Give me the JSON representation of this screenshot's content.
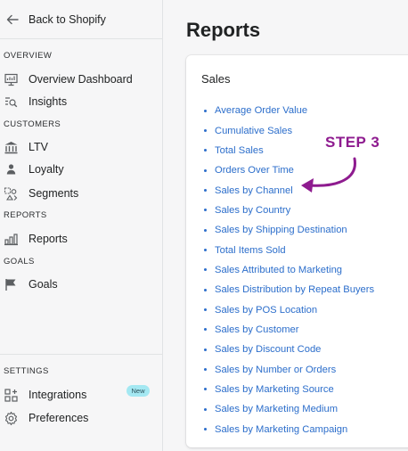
{
  "sidebar": {
    "back_label": "Back to Shopify",
    "sections": {
      "overview": "OVERVIEW",
      "customers": "CUSTOMERS",
      "reports": "REPORTS",
      "goals": "GOALS",
      "settings": "SETTINGS"
    },
    "items": {
      "overview_dashboard": {
        "label": "Overview Dashboard",
        "icon": "dashboard-icon"
      },
      "insights": {
        "label": "Insights",
        "icon": "insights-icon"
      },
      "ltv": {
        "label": "LTV",
        "icon": "bank-icon"
      },
      "loyalty": {
        "label": "Loyalty",
        "icon": "person-icon"
      },
      "segments": {
        "label": "Segments",
        "icon": "segments-icon"
      },
      "reports": {
        "label": "Reports",
        "icon": "bar-chart-icon"
      },
      "goals": {
        "label": "Goals",
        "icon": "flag-icon"
      },
      "integrations": {
        "label": "Integrations",
        "icon": "integrations-icon",
        "badge": "New"
      },
      "preferences": {
        "label": "Preferences",
        "icon": "gear-icon"
      }
    }
  },
  "main": {
    "title": "Reports",
    "card": {
      "title": "Sales",
      "links": [
        "Average Order Value",
        "Cumulative Sales",
        "Total Sales",
        "Orders Over Time",
        "Sales by Channel",
        "Sales by Country",
        "Sales by Shipping Destination",
        "Total Items Sold",
        "Sales Attributed to Marketing",
        "Sales Distribution by Repeat Buyers",
        "Sales by POS Location",
        "Sales by Customer",
        "Sales by Discount Code",
        "Sales by Number or Orders",
        "Sales by Marketing Source",
        "Sales by Marketing Medium",
        "Sales by Marketing Campaign"
      ]
    }
  },
  "annotation": {
    "label": "STEP 3",
    "color": "#8e1b8f"
  },
  "colors": {
    "link": "#2c6ecb",
    "badge": "#a4e8f2"
  }
}
